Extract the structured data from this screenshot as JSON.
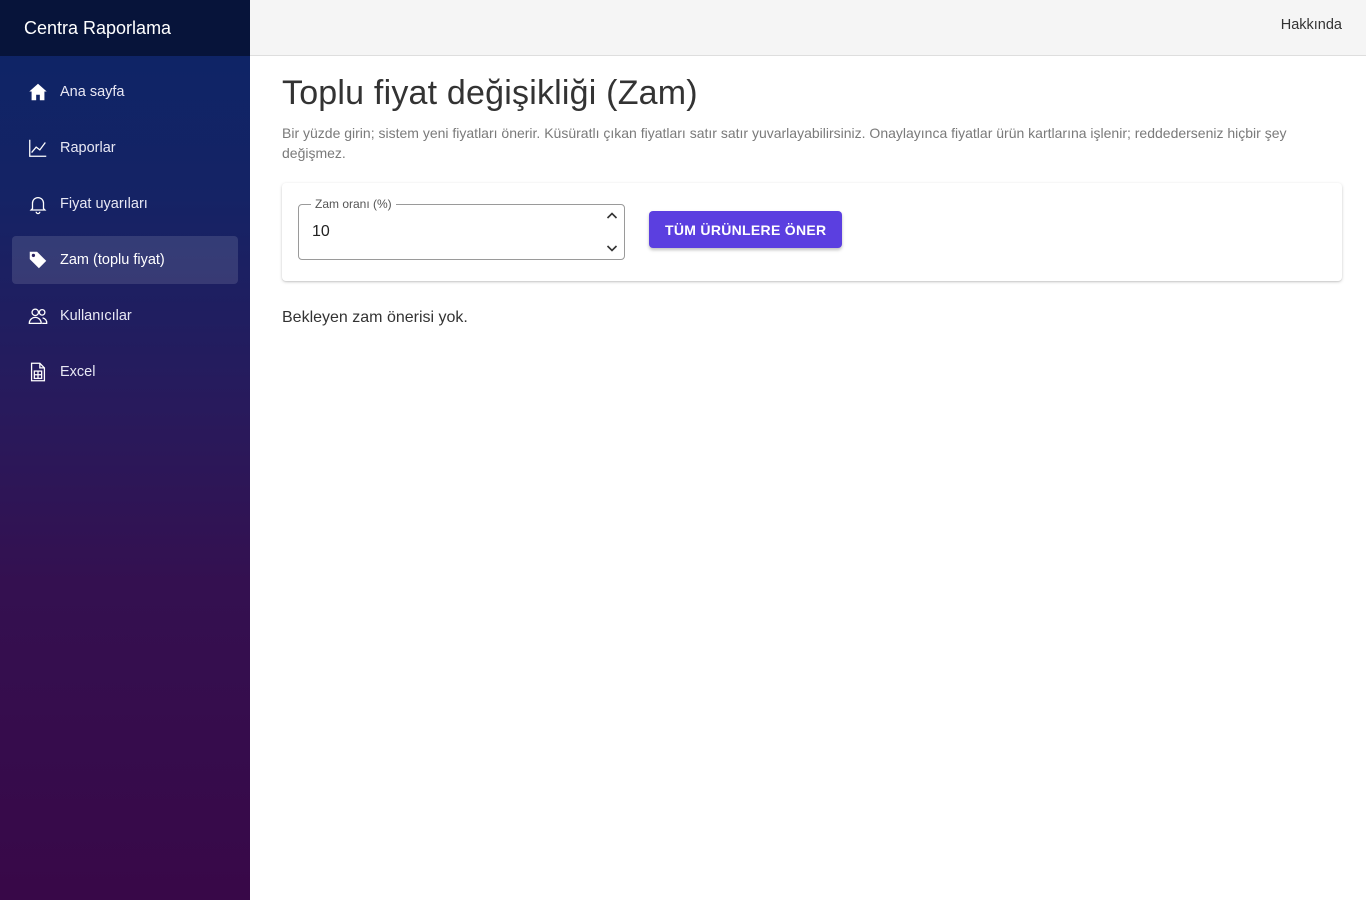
{
  "app": {
    "brand": "Centra Raporlama"
  },
  "topbar": {
    "about_label": "Hakkında"
  },
  "sidebar": {
    "items": [
      {
        "label": "Ana sayfa",
        "icon": "home-icon",
        "active": false
      },
      {
        "label": "Raporlar",
        "icon": "chart-line-icon",
        "active": false
      },
      {
        "label": "Fiyat uyarıları",
        "icon": "bell-icon",
        "active": false
      },
      {
        "label": "Zam (toplu fiyat)",
        "icon": "tag-icon",
        "active": true
      },
      {
        "label": "Kullanıcılar",
        "icon": "users-icon",
        "active": false
      },
      {
        "label": "Excel",
        "icon": "spreadsheet-icon",
        "active": false
      }
    ]
  },
  "main": {
    "title": "Toplu fiyat değişikliği (Zam)",
    "description": "Bir yüzde girin; sistem yeni fiyatları önerir. Küsüratlı çıkan fiyatları satır satır yuvarlayabilirsiniz. Onaylayınca fiyatlar ürün kartlarına işlenir; reddederseniz hiçbir şey değişmez.",
    "form": {
      "rate_label": "Zam oranı (%)",
      "rate_value": "10",
      "propose_button": "TÜM ÜRÜNLERE ÖNER"
    },
    "empty_message": "Bekleyen zam önerisi yok."
  },
  "colors": {
    "accent": "#5b3fe0",
    "brand_bar": "#07143a",
    "sidebar_top": "#0c2466",
    "sidebar_bottom": "#380848"
  }
}
